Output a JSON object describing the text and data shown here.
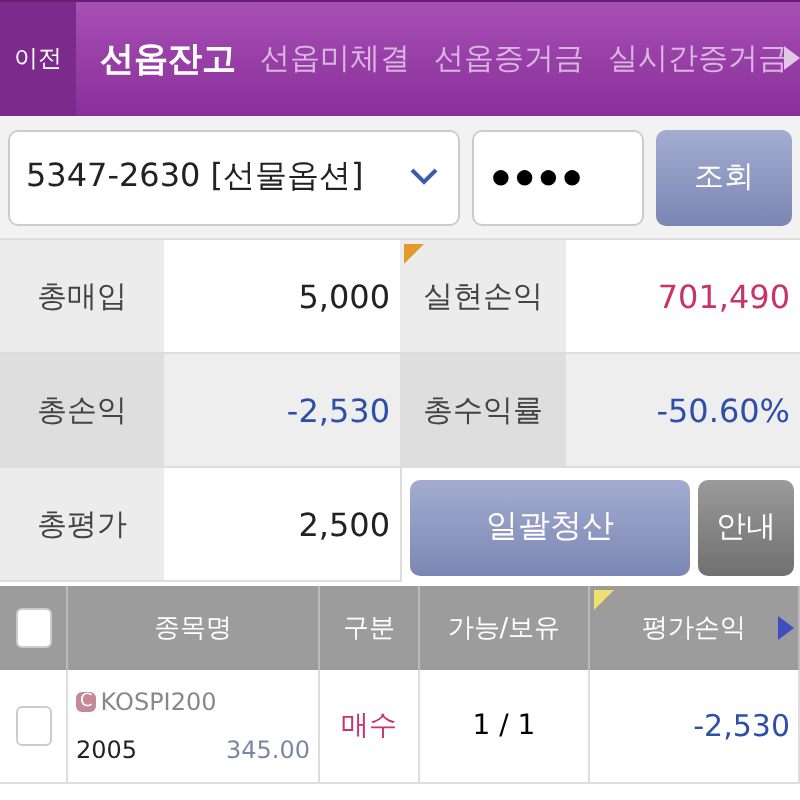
{
  "header": {
    "back_button": "이전",
    "tabs": [
      {
        "label": "선옵잔고",
        "selected": true
      },
      {
        "label": "선옵미체결",
        "selected": false
      },
      {
        "label": "선옵증거금",
        "selected": false
      },
      {
        "label": "실시간증거금",
        "selected": false
      }
    ]
  },
  "account": {
    "value": "5347-2630 [선물옵션]",
    "password": "●●●●",
    "query_button": "조회"
  },
  "summary": [
    {
      "label": "총매입",
      "value": "5,000",
      "color": "#222222"
    },
    {
      "label": "실현손익",
      "value": "701,490",
      "color": "#c8336a"
    },
    {
      "label": "총손익",
      "value": "-2,530",
      "color": "#2d4fa8"
    },
    {
      "label": "총수익률",
      "value": "-50.60%",
      "color": "#2d4fa8"
    },
    {
      "label": "총평가",
      "value": "2,500",
      "color": "#222222"
    }
  ],
  "buttons": {
    "liquidate": "일괄청산",
    "guide": "안내"
  },
  "table": {
    "select_all": false,
    "columns": [
      "종목명",
      "구분",
      "가능/보유",
      "평가손익"
    ],
    "rows": [
      {
        "checked": false,
        "badge": "C",
        "name": "KOSPI200",
        "code": "2005",
        "price": "345.00",
        "side": {
          "text": "매수",
          "color": "#c8336a"
        },
        "qty": "1 / 1",
        "pnl": {
          "text": "-2,530",
          "color": "#2d4fa8"
        }
      }
    ]
  }
}
